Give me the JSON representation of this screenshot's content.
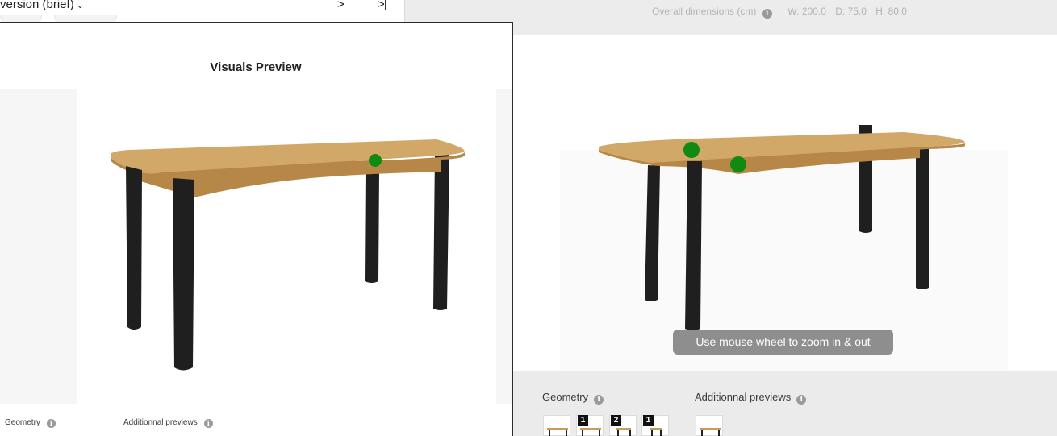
{
  "header": {
    "version_label": "version (brief)",
    "next_symbol": ">",
    "last_symbol": ">|",
    "dims_label": "Overall dimensions (cm)",
    "dim_w": "W: 200.0",
    "dim_d": "D: 75.0",
    "dim_h": "H: 80.0"
  },
  "main": {
    "zoom_hint": "Use mouse wheel to zoom in & out",
    "geometry_label": "Geometry",
    "additional_label": "Additionnal previews",
    "geometry_thumbs": [
      {
        "badge": ""
      },
      {
        "badge": "1"
      },
      {
        "badge": "2"
      },
      {
        "badge": "1"
      }
    ]
  },
  "modal": {
    "title": "Visuals Preview",
    "geometry_label": "Geometry",
    "additional_label": "Additionnal previews"
  },
  "icons": {
    "info": "info-icon",
    "chevron": "chevron-down-icon",
    "marker": "hotspot-marker-icon"
  },
  "colors": {
    "wood": "#d2a868",
    "wood_edge": "#b68747",
    "leg": "#1f1f1f",
    "marker": "#118a11",
    "zoom_hint_bg": "#8e8e8e"
  },
  "info_glyph": "i"
}
